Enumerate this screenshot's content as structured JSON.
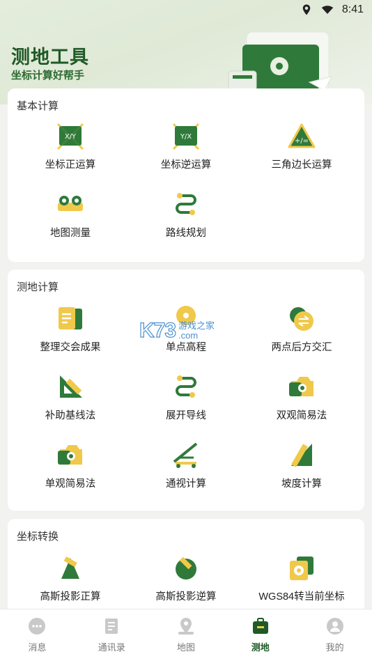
{
  "status": {
    "time": "8:41"
  },
  "header": {
    "title": "测地工具",
    "subtitle": "坐标计算好帮手"
  },
  "sections": [
    {
      "title": "基本计算",
      "items": [
        {
          "label": "坐标正运算",
          "icon": "xy-board-icon"
        },
        {
          "label": "坐标逆运算",
          "icon": "yx-board-icon"
        },
        {
          "label": "三角边长运算",
          "icon": "triangle-calc-icon"
        },
        {
          "label": "地图测量",
          "icon": "map-measure-icon"
        },
        {
          "label": "路线规划",
          "icon": "route-plan-icon"
        }
      ]
    },
    {
      "title": "测地计算",
      "items": [
        {
          "label": "整理交会成果",
          "icon": "document-icon"
        },
        {
          "label": "单点高程",
          "icon": "elevation-icon"
        },
        {
          "label": "两点后方交汇",
          "icon": "two-point-icon"
        },
        {
          "label": "补助基线法",
          "icon": "ruler-triangle-icon"
        },
        {
          "label": "展开导线",
          "icon": "route-plan-icon"
        },
        {
          "label": "双观简易法",
          "icon": "camera-icon"
        },
        {
          "label": "单观简易法",
          "icon": "camera-icon"
        },
        {
          "label": "通视计算",
          "icon": "sightline-icon"
        },
        {
          "label": "坡度计算",
          "icon": "slope-icon"
        }
      ]
    },
    {
      "title": "坐标转换",
      "items": [
        {
          "label": "高斯投影正算",
          "icon": "projection-icon"
        },
        {
          "label": "高斯投影逆算",
          "icon": "projection-inverse-icon"
        },
        {
          "label": "WGS84转当前坐标",
          "icon": "wgs-convert-icon"
        }
      ]
    }
  ],
  "tabs": [
    {
      "label": "消息",
      "icon": "message-icon",
      "active": false
    },
    {
      "label": "通讯录",
      "icon": "contacts-icon",
      "active": false
    },
    {
      "label": "地图",
      "icon": "map-pin-icon",
      "active": false
    },
    {
      "label": "测地",
      "icon": "toolbox-icon",
      "active": true
    },
    {
      "label": "我的",
      "icon": "profile-icon",
      "active": false
    }
  ],
  "watermark": {
    "brand": "K73",
    "text1": "游戏之家",
    "text2": ".com"
  },
  "colors": {
    "primary_green": "#1f5a26",
    "accent_yellow": "#f0c94a",
    "icon_green": "#3f8a3f"
  }
}
